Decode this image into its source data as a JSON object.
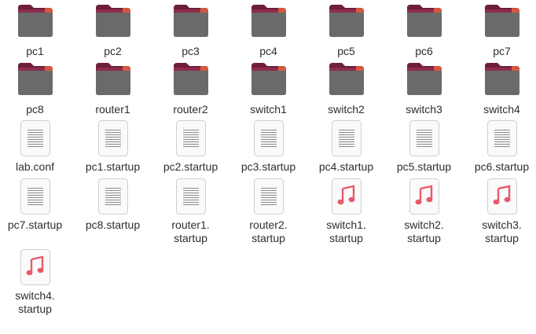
{
  "files": [
    {
      "name": "pc1",
      "type": "folder",
      "icon": "folder-icon"
    },
    {
      "name": "pc2",
      "type": "folder",
      "icon": "folder-icon"
    },
    {
      "name": "pc3",
      "type": "folder",
      "icon": "folder-icon"
    },
    {
      "name": "pc4",
      "type": "folder",
      "icon": "folder-icon"
    },
    {
      "name": "pc5",
      "type": "folder",
      "icon": "folder-icon"
    },
    {
      "name": "pc6",
      "type": "folder",
      "icon": "folder-icon"
    },
    {
      "name": "pc7",
      "type": "folder",
      "icon": "folder-icon"
    },
    {
      "name": "pc8",
      "type": "folder",
      "icon": "folder-icon"
    },
    {
      "name": "router1",
      "type": "folder",
      "icon": "folder-icon"
    },
    {
      "name": "router2",
      "type": "folder",
      "icon": "folder-icon"
    },
    {
      "name": "switch1",
      "type": "folder",
      "icon": "folder-icon"
    },
    {
      "name": "switch2",
      "type": "folder",
      "icon": "folder-icon"
    },
    {
      "name": "switch3",
      "type": "folder",
      "icon": "folder-icon"
    },
    {
      "name": "switch4",
      "type": "folder",
      "icon": "folder-icon"
    },
    {
      "name": "lab.conf",
      "type": "text",
      "icon": "text-file-icon"
    },
    {
      "name": "pc1.startup",
      "type": "text",
      "icon": "text-file-icon"
    },
    {
      "name": "pc2.startup",
      "type": "text",
      "icon": "text-file-icon"
    },
    {
      "name": "pc3.startup",
      "type": "text",
      "icon": "text-file-icon"
    },
    {
      "name": "pc4.startup",
      "type": "text",
      "icon": "text-file-icon"
    },
    {
      "name": "pc5.startup",
      "type": "text",
      "icon": "text-file-icon"
    },
    {
      "name": "pc6.startup",
      "type": "text",
      "icon": "text-file-icon"
    },
    {
      "name": "pc7.startup",
      "type": "text",
      "icon": "text-file-icon"
    },
    {
      "name": "pc8.startup",
      "type": "text",
      "icon": "text-file-icon"
    },
    {
      "name": "router1.\nstartup",
      "type": "text",
      "icon": "text-file-icon"
    },
    {
      "name": "router2.\nstartup",
      "type": "text",
      "icon": "text-file-icon"
    },
    {
      "name": "switch1.\nstartup",
      "type": "audio",
      "icon": "audio-file-icon"
    },
    {
      "name": "switch2.\nstartup",
      "type": "audio",
      "icon": "audio-file-icon"
    },
    {
      "name": "switch3.\nstartup",
      "type": "audio",
      "icon": "audio-file-icon"
    },
    {
      "name": "switch4.\nstartup",
      "type": "audio",
      "icon": "audio-file-icon"
    }
  ],
  "colors": {
    "folder_body": "#6a6a6a",
    "folder_tab": "#8c2c4c",
    "folder_tab_dark": "#6e1f3a",
    "folder_accent": "#e06240",
    "doc_bg": "#fafafa",
    "doc_border": "#cfcfcf",
    "doc_lines": "#8a8a8a",
    "audio_note": "#e95a6a",
    "label_text": "#2e2e2e"
  }
}
